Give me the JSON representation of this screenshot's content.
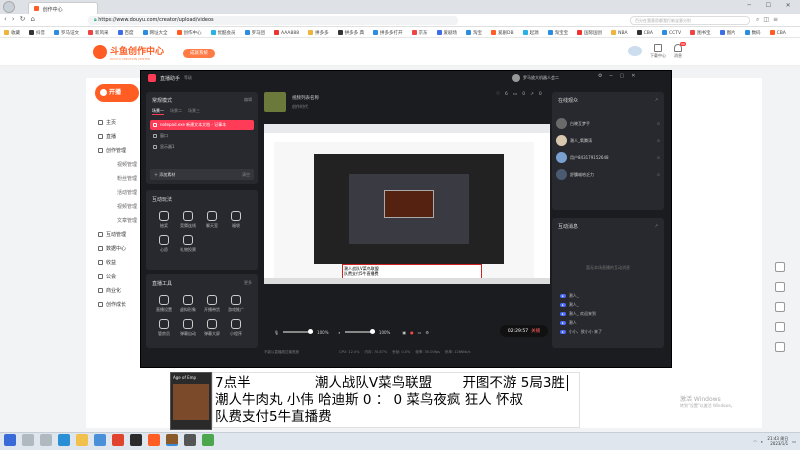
{
  "browser": {
    "tabs": [
      "创作中心"
    ],
    "url": "https://www.douyu.com/creator/upload/videos",
    "search_placeholder": "百分在我意愿都我打新宝意分别",
    "bookmarks": [
      "收藏",
      "抖音",
      "罗马证文",
      "新风采",
      "百度",
      "网址大全",
      "创作中心",
      "优酷会员",
      "罗马团",
      "AAA888",
      "拼多多",
      "拼多多 典",
      "拼多多打开",
      "京东",
      "爱剧场",
      "淘宝",
      "爱剧DB",
      "起源",
      "淘宝宝",
      "国际国创",
      "NBA",
      "CBA",
      "CCTV",
      "图书宝",
      "图片",
      "数码",
      "CBA"
    ]
  },
  "site": {
    "logo": "斗鱼创作中心",
    "logo_sub": "DOUYU CREATION CENTER",
    "upgrade_btn": "成就系统",
    "right_items": [
      "下载中心",
      "消息"
    ],
    "notif_count": "99"
  },
  "sidebar": {
    "start_btn": "开播",
    "items": [
      "主页",
      "直播",
      "创作管理",
      "视频管理",
      "粉丝管理",
      "活动管理",
      "视频管理",
      "文章管理",
      "互动管理",
      "数据中心",
      "收益",
      "公会",
      "商业化",
      "创作成长"
    ]
  },
  "obs": {
    "title": "直播助手",
    "title_sub": "等级",
    "video_title": "视频列表名称",
    "video_sub": "创作时代",
    "stats": {
      "likes": "6",
      "comments": "0",
      "shares": "0"
    },
    "user_name": "罗马放大机器人会二",
    "scene_label": "常规模式",
    "layout_btn": "编辑",
    "scene_tabs": [
      "场景一",
      "场景二",
      "场景三"
    ],
    "sources": [
      {
        "name": "notepad.exe 新建文本文档 - 记事本",
        "active": true
      },
      {
        "name": "窗口",
        "active": false
      },
      {
        "name": "显示器1",
        "active": false
      }
    ],
    "add_source": "添加素材",
    "add_source_right": "清空",
    "interact_title": "互动玩法",
    "interact_tools": [
      "抽奖",
      "竞猜连线",
      "聊天室",
      "福袋",
      "心愿",
      "礼物投票"
    ],
    "live_tools_title": "直播工具",
    "live_tools_more": "更多",
    "live_tools": [
      "直播设置",
      "虚拟形象",
      "开播带货",
      "游戏推广",
      "管房员",
      "弹幕自动",
      "弹幕大屏",
      "小程序"
    ],
    "volume1": "100%",
    "volume2": "100%",
    "timer": "02:29:57",
    "end_btn": "关播",
    "status_left": "不能以直播超过最宽度",
    "status_items": [
      "CPU: 12.0%",
      "内存: 70.87%",
      "丢帧: 0.0%",
      "帧率: 30.00fps",
      "码率: 1266kb/s"
    ],
    "viewers_title": "在线观众",
    "viewers": [
      "白晓互梦手",
      "潮人_氧腾涛",
      "用户843179152648",
      "舒醺喵哈乏力"
    ],
    "messages_title": "互动消息",
    "messages_placeholder": "暂无本场直播的互动消息",
    "messages": [
      "潮人_",
      "潮人_",
      "潮人_ 欢迎来到",
      "潮人",
      "小小、欲小小 来了"
    ]
  },
  "overlay": {
    "line1_a": "7点半",
    "line1_b": "潮人战队V菜鸟联盟",
    "line1_c": "开图不游 5局3胜",
    "line2": "潮人牛肉丸 小伟 哈迪斯  0 ： 0  菜鸟夜疯  狂人 怀叔",
    "line3": "队费支付5牛直播费",
    "thumb_title": "Age of Emp"
  },
  "watermark": {
    "line1": "激活 Windows",
    "line2": "转到\"设置\"以激活 Windows。"
  },
  "taskbar": {
    "time": "21:43",
    "date": "2023/1/1",
    "tray": "周日"
  },
  "colors": {
    "accent": "#ff5d23",
    "obs_red": "#ff3c58",
    "dark": "#1f2024"
  }
}
